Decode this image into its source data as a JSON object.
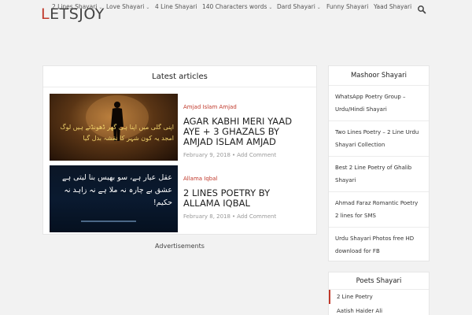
{
  "nav": {
    "items": [
      {
        "label": "2 Lines Shayari",
        "dropdown": true
      },
      {
        "label": "Love Shayari",
        "dropdown": true
      },
      {
        "label": "4 Line Shayari",
        "dropdown": false
      },
      {
        "label": "140 Characters words",
        "dropdown": true
      },
      {
        "label": "Dard Shayari",
        "dropdown": true
      },
      {
        "label": "Funny Shayari",
        "dropdown": false
      },
      {
        "label": "Yaad Shayari",
        "dropdown": false
      }
    ],
    "search_icon": "search-icon"
  },
  "logo": {
    "first": "L",
    "rest": "ETSJOY",
    "accent": "#c0392b"
  },
  "latest": {
    "heading": "Latest articles",
    "articles": [
      {
        "category": "Amjad Islam Amjad",
        "title": "Agar Kabhi Meri Yaad Aye + 3 Ghazals by Amjad Islam Amjad",
        "date": "February 9, 2018",
        "comment": "Add Comment",
        "thumb_lines": [
          "اپنی گلی میں اپنا ہی گھر ڈھونڈتے ہیں لوگ",
          "امجد یہ کون شہر کا نقشہ بدل گیا"
        ]
      },
      {
        "category": "Allama Iqbal",
        "title": "2 Lines Poetry by Allama Iqbal",
        "date": "February 8, 2018",
        "comment": "Add Comment",
        "thumb_lines": [
          "عقل عیار ہے، سو بھیس بنا لیتی ہے",
          "عشق بے چارہ نہ ملا ہے نہ زاہد نہ حکیم!"
        ]
      }
    ],
    "separator": "•"
  },
  "ads": {
    "label": "Advertisements"
  },
  "sidebar": {
    "mashoor": {
      "heading": "Mashoor Shayari",
      "items": [
        "WhatsApp Poetry Group – Urdu/Hindi Shayari",
        "Two Lines Poetry – 2 Line Urdu Shayari Collection",
        "Best 2 Line Poetry of Ghalib Shayari",
        "Ahmad Faraz Romantic Poetry 2 lines for SMS",
        "Urdu Shayari Photos free HD download for FB"
      ]
    },
    "poets": {
      "heading": "Poets Shayari",
      "items": [
        "2 Line Poetry",
        "Aatish Haider Ali"
      ]
    }
  }
}
